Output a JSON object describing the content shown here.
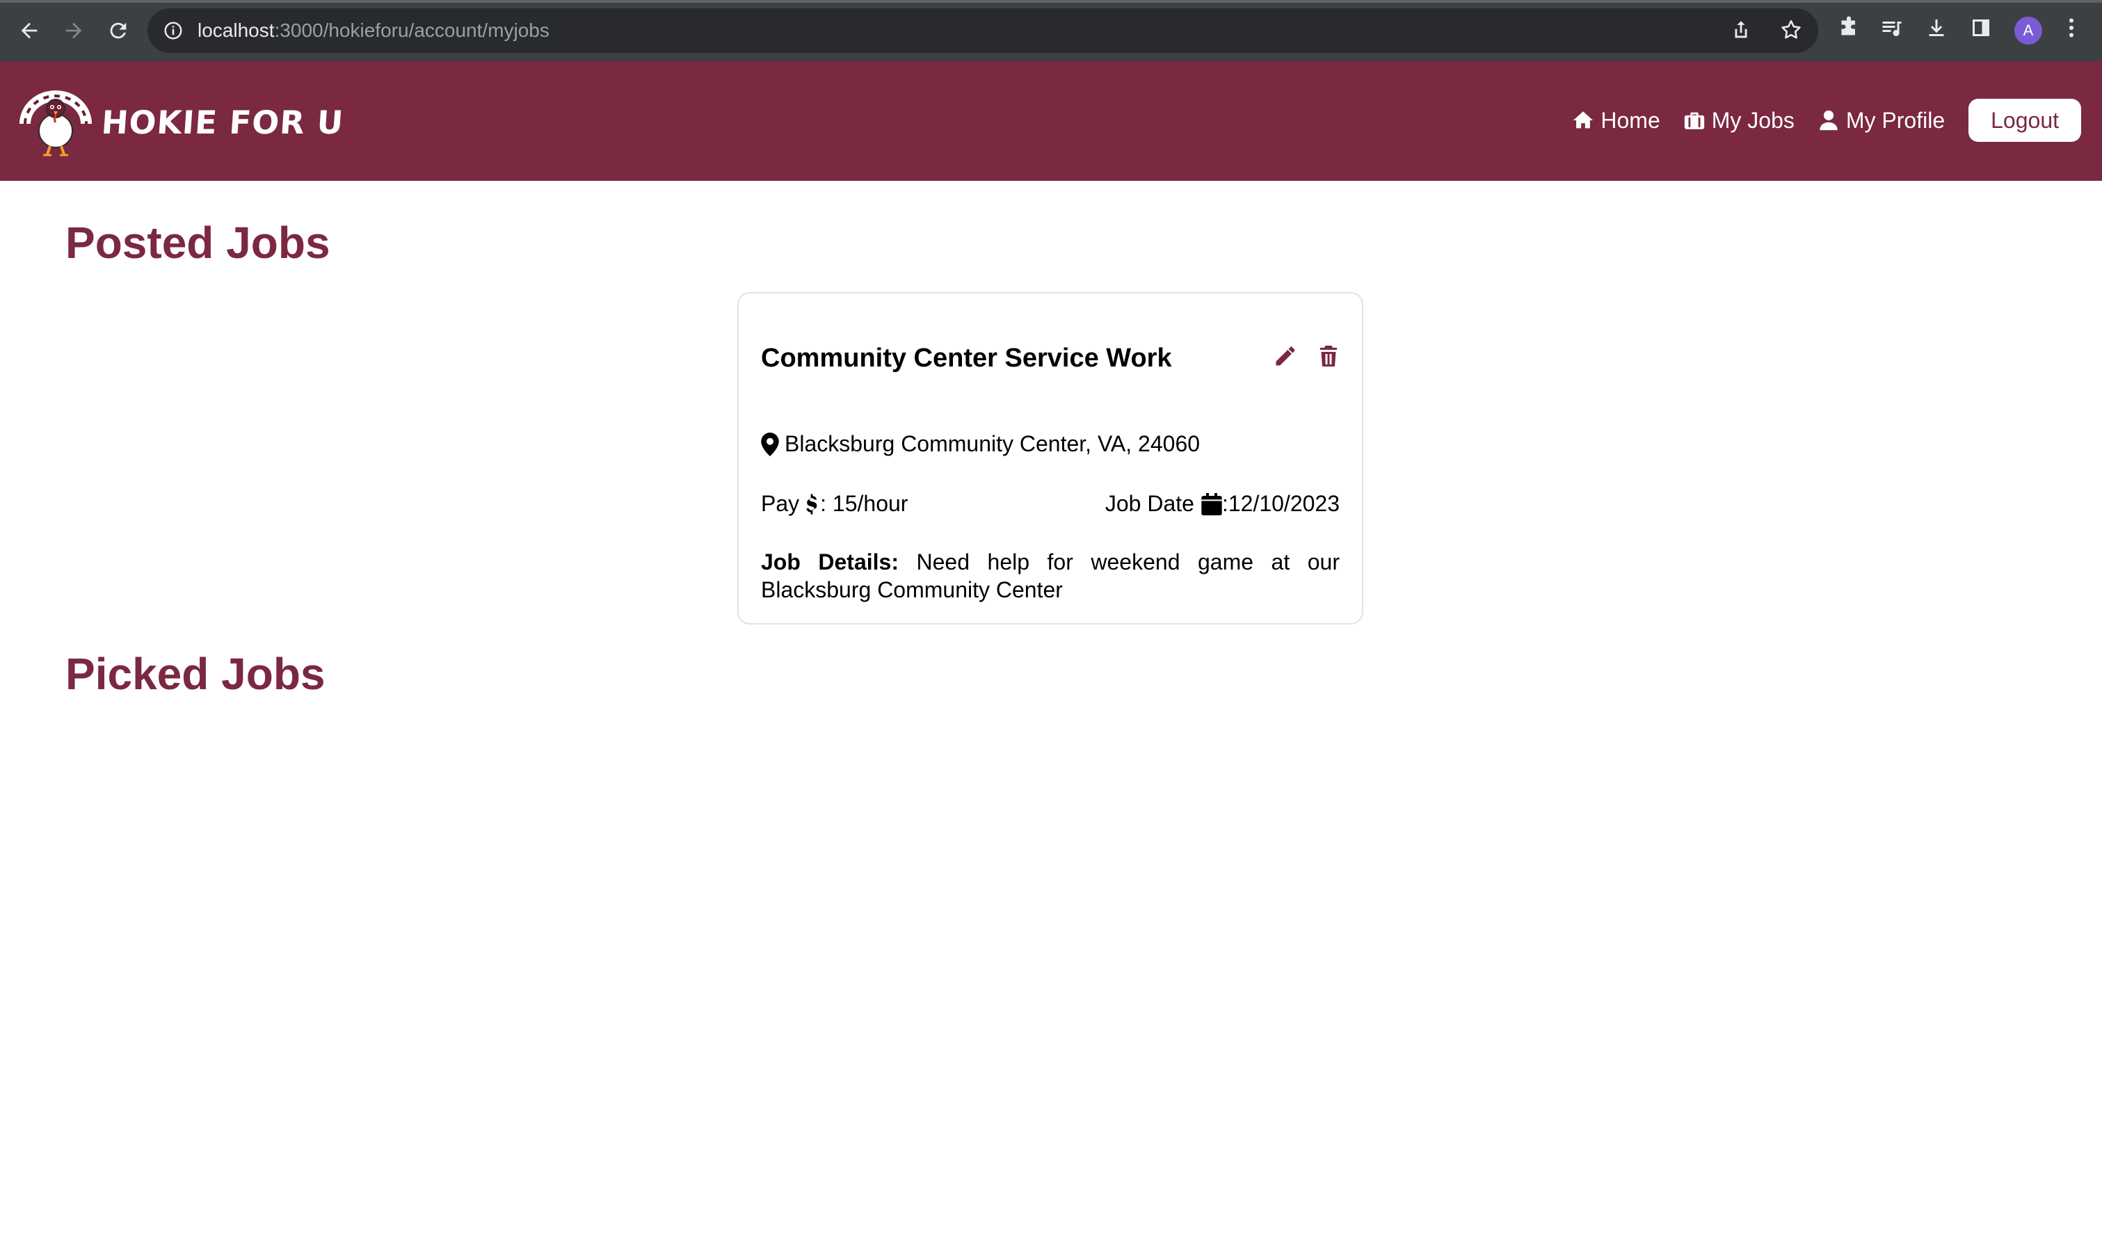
{
  "browser": {
    "url_host": "localhost",
    "url_path": ":3000/hokieforu/account/myjobs",
    "profile_initial": "A"
  },
  "navbar": {
    "brand": "HOKIE FOR U",
    "links": [
      {
        "label": "Home",
        "icon": "home-icon"
      },
      {
        "label": "My Jobs",
        "icon": "briefcase-icon"
      },
      {
        "label": "My Profile",
        "icon": "user-icon"
      }
    ],
    "logout_label": "Logout",
    "color": "#7b2841"
  },
  "posted_jobs": {
    "heading": "Posted Jobs",
    "jobs": [
      {
        "title": "Community Center Service Work",
        "location": "Blacksburg Community Center, VA, 24060",
        "pay_label": "Pay",
        "pay_value": ": 15/hour",
        "date_label": "Job Date",
        "date_value": ":12/10/2023",
        "details_label": "Job Details:",
        "details": "Need help for weekend game at our Blacksburg Community Center"
      }
    ]
  },
  "picked_jobs": {
    "heading": "Picked Jobs"
  }
}
